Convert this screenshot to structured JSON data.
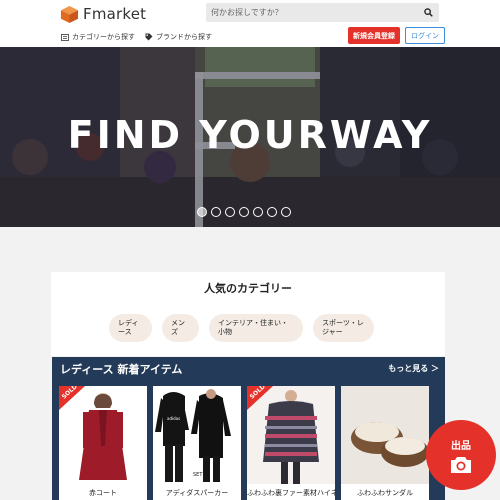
{
  "header": {
    "logo_text": "Fmarket",
    "search_placeholder": "何かお探しですか？",
    "nav": [
      {
        "label": "カテゴリーから探す",
        "icon": "list-icon"
      },
      {
        "label": "ブランドから探す",
        "icon": "tag-icon"
      }
    ],
    "signup_label": "新規会員登録",
    "login_label": "ログイン"
  },
  "hero": {
    "title": "FIND YOURWAY",
    "dot_count": 7,
    "active_index": 0
  },
  "categories": {
    "title": "人気のカテゴリー",
    "items": [
      {
        "label": "レディース"
      },
      {
        "label": "メンズ"
      },
      {
        "label": "インテリア・住まい・小物"
      },
      {
        "label": "スポーツ・レジャー"
      }
    ]
  },
  "new_items": {
    "title": "レディース 新着アイテム",
    "more_label": "もっと見る ＞",
    "products": [
      {
        "name": "赤コート",
        "sold": true
      },
      {
        "name": "アディダスパーカー",
        "sold": false
      },
      {
        "name": "ふわふわ裏ファー素材ハイネックプルオーバー",
        "sold": true
      },
      {
        "name": "ふわふわサンダル",
        "sold": false
      }
    ],
    "sold_label": "SOLD"
  },
  "fab": {
    "label": "出品"
  },
  "colors": {
    "brand": "#e4322b",
    "navy": "#233a59",
    "login": "#3a8edb",
    "logo": "#e87a2c"
  }
}
